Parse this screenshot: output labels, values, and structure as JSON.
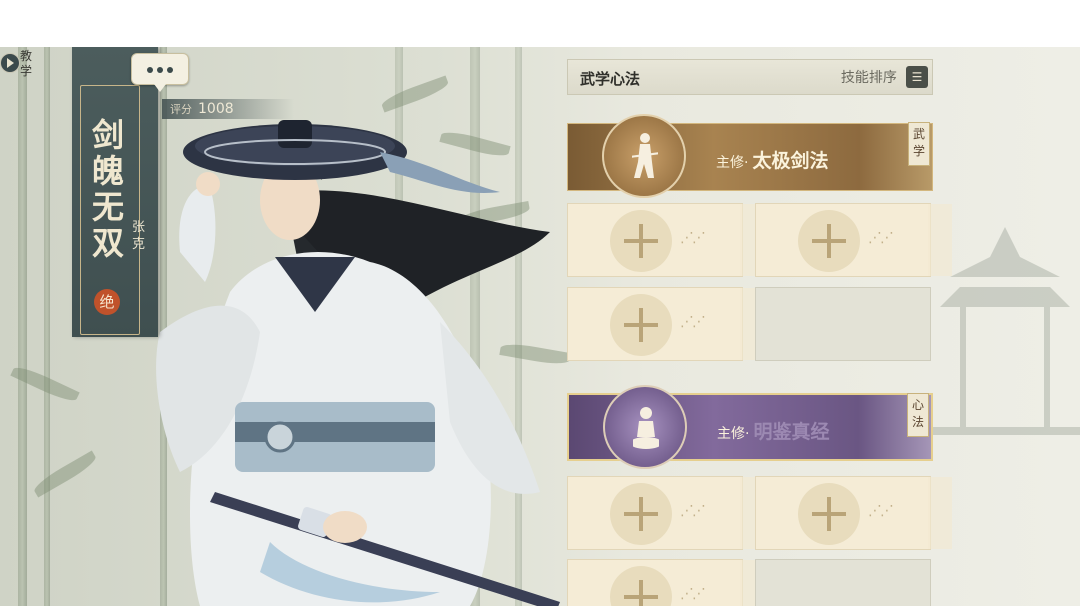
{
  "tutorial": {
    "label": "教学"
  },
  "character": {
    "name": "剑魄无双",
    "actor": "张克",
    "rank": "绝",
    "score_label": "评分",
    "score_value": "1008"
  },
  "panel": {
    "title": "武学心法",
    "sort_label": "技能排序",
    "wuxue": {
      "prefix": "主修·",
      "skill": "太极剑法",
      "tag": "武学"
    },
    "xinfa": {
      "prefix": "主修·",
      "skill": "明鉴真经",
      "tag": "心法"
    }
  },
  "colors": {
    "wuxue_card": "#a88350",
    "xinfa_card": "#826a9c",
    "banner": "#4c5d5d",
    "rank_badge": "#c0522b"
  },
  "icons": [
    "play-icon",
    "more-icon",
    "sort-icon",
    "plus-icon",
    "footprints-icon",
    "swordsman-emblem-icon",
    "meditation-emblem-icon"
  ]
}
